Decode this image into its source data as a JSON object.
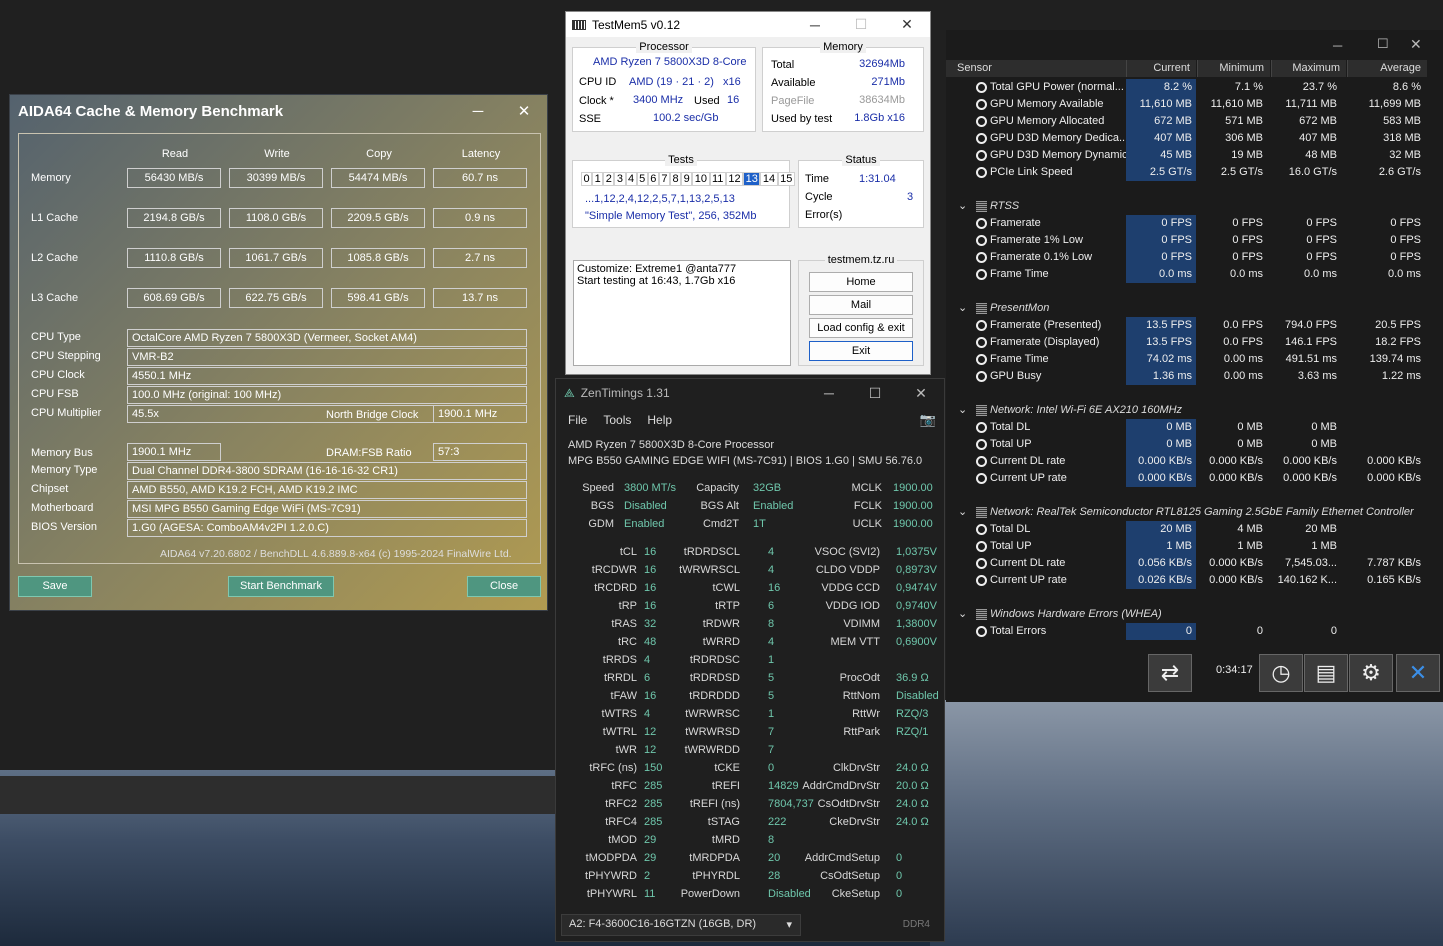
{
  "aida": {
    "title": "AIDA64 Cache & Memory Benchmark",
    "min": "─",
    "close": "✕",
    "headers": [
      "Read",
      "Write",
      "Copy",
      "Latency"
    ],
    "rows": [
      {
        "label": "Memory",
        "read": "56430 MB/s",
        "write": "30399 MB/s",
        "copy": "54474 MB/s",
        "latency": "60.7 ns"
      },
      {
        "label": "L1 Cache",
        "read": "2194.8 GB/s",
        "write": "1108.0 GB/s",
        "copy": "2209.5 GB/s",
        "latency": "0.9 ns"
      },
      {
        "label": "L2 Cache",
        "read": "1110.8 GB/s",
        "write": "1061.7 GB/s",
        "copy": "1085.8 GB/s",
        "latency": "2.7 ns"
      },
      {
        "label": "L3 Cache",
        "read": "608.69 GB/s",
        "write": "622.75 GB/s",
        "copy": "598.41 GB/s",
        "latency": "13.7 ns"
      }
    ],
    "info": [
      {
        "label": "CPU Type",
        "value": "OctalCore AMD Ryzen 7 5800X3D  (Vermeer, Socket AM4)"
      },
      {
        "label": "CPU Stepping",
        "value": "VMR-B2"
      },
      {
        "label": "CPU Clock",
        "value": "4550.1 MHz"
      },
      {
        "label": "CPU FSB",
        "value": "100.0 MHz  (original: 100 MHz)"
      },
      {
        "label": "CPU Multiplier",
        "value": "45.5x"
      }
    ],
    "nb_label": "North Bridge Clock",
    "nb_value": "1900.1 MHz",
    "bus_label": "Memory Bus",
    "bus_value": "1900.1 MHz",
    "ratio_label": "DRAM:FSB Ratio",
    "ratio_value": "57:3",
    "info2": [
      {
        "label": "Memory Type",
        "value": "Dual Channel DDR4-3800 SDRAM  (16-16-16-32 CR1)"
      },
      {
        "label": "Chipset",
        "value": "AMD B550, AMD K19.2 FCH, AMD K19.2 IMC"
      },
      {
        "label": "Motherboard",
        "value": "MSI MPG B550 Gaming Edge WiFi (MS-7C91)"
      },
      {
        "label": "BIOS Version",
        "value": "1.G0  (AGESA: ComboAM4v2PI 1.2.0.C)"
      }
    ],
    "footer": "AIDA64 v7.20.6802 / BenchDLL 4.6.889.8-x64  (c) 1995-2024 FinalWire Ltd.",
    "save": "Save",
    "start": "Start Benchmark",
    "close_btn": "Close"
  },
  "tm": {
    "title": "TestMem5 v0.12",
    "proc_title": "Processor",
    "cpu_name": "AMD Ryzen 7 5800X3D 8-Core",
    "cpuid_l": "CPU ID",
    "cpuid_v": "AMD  (19 · 21 · 2)",
    "cpuid_x": "x16",
    "clock_l": "Clock *",
    "clock_v": "3400 MHz",
    "used_l": "Used",
    "used_v": "16",
    "sse_l": "SSE",
    "sse_v": "100.2 sec/Gb",
    "mem_title": "Memory",
    "total_l": "Total",
    "total_v": "32694Mb",
    "avail_l": "Available",
    "avail_v": "271Mb",
    "pf_l": "PageFile",
    "pf_v": "38634Mb",
    "ubt_l": "Used by test",
    "ubt_v": "1.8Gb x16",
    "tests_title": "Tests",
    "tests": [
      "0",
      "1",
      "2",
      "3",
      "4",
      "5",
      "6",
      "7",
      "8",
      "9",
      "10",
      "11",
      "12",
      "13",
      "14",
      "15"
    ],
    "seq": "...1,12,2,4,12,2,5,7,1,13,2,5,13",
    "desc": "\"Simple Memory Test\", 256, 352Mb",
    "status_title": "Status",
    "time_l": "Time",
    "time_v": "1:31.04",
    "cycle_l": "Cycle",
    "cycle_v": "3",
    "err_l": "Error(s)",
    "log1": "Customize: Extreme1 @anta777",
    "log2": "Start testing at 16:43, 1.7Gb x16",
    "site": "testmem.tz.ru",
    "home": "Home",
    "mail": "Mail",
    "load": "Load config & exit",
    "exit": "Exit"
  },
  "zen": {
    "title": "ZenTimings 1.31",
    "menu": [
      "File",
      "Tools",
      "Help"
    ],
    "cpu": "AMD Ryzen 7 5800X3D 8-Core Processor",
    "board": "MPG B550 GAMING EDGE WIFI (MS-7C91) | BIOS 1.G0 | SMU 56.76.0",
    "top": [
      [
        "Speed",
        "3800 MT/s",
        "Capacity",
        "32GB",
        "MCLK",
        "1900.00"
      ],
      [
        "BGS",
        "Disabled",
        "BGS Alt",
        "Enabled",
        "FCLK",
        "1900.00"
      ],
      [
        "GDM",
        "Enabled",
        "Cmd2T",
        "1T",
        "UCLK",
        "1900.00"
      ]
    ],
    "rows": [
      [
        "tCL",
        "16",
        "tRDRDSCL",
        "4",
        "VSOC (SVI2)",
        "1,0375V"
      ],
      [
        "tRCDWR",
        "16",
        "tWRWRSCL",
        "4",
        "CLDO VDDP",
        "0,8973V"
      ],
      [
        "tRCDRD",
        "16",
        "tCWL",
        "16",
        "VDDG CCD",
        "0,9474V"
      ],
      [
        "tRP",
        "16",
        "tRTP",
        "6",
        "VDDG IOD",
        "0,9740V"
      ],
      [
        "tRAS",
        "32",
        "tRDWR",
        "8",
        "VDIMM",
        "1,3800V"
      ],
      [
        "tRC",
        "48",
        "tWRRD",
        "4",
        "MEM VTT",
        "0,6900V"
      ],
      [
        "tRRDS",
        "4",
        "tRDRDSC",
        "1",
        "",
        ""
      ],
      [
        "tRRDL",
        "6",
        "tRDRDSD",
        "5",
        "ProcOdt",
        "36.9 Ω"
      ],
      [
        "tFAW",
        "16",
        "tRDRDDD",
        "5",
        "RttNom",
        "Disabled"
      ],
      [
        "tWTRS",
        "4",
        "tWRWRSC",
        "1",
        "RttWr",
        "RZQ/3"
      ],
      [
        "tWTRL",
        "12",
        "tWRWRSD",
        "7",
        "RttPark",
        "RZQ/1"
      ],
      [
        "tWR",
        "12",
        "tWRWRDD",
        "7",
        "",
        ""
      ],
      [
        "tRFC (ns)",
        "150",
        "tCKE",
        "0",
        "ClkDrvStr",
        "24.0 Ω"
      ],
      [
        "tRFC",
        "285",
        "tREFI",
        "14829",
        "AddrCmdDrvStr",
        "20.0 Ω"
      ],
      [
        "tRFC2",
        "285",
        "tREFI (ns)",
        "7804,737",
        "CsOdtDrvStr",
        "24.0 Ω"
      ],
      [
        "tRFC4",
        "285",
        "tSTAG",
        "222",
        "CkeDrvStr",
        "24.0 Ω"
      ],
      [
        "tMOD",
        "29",
        "tMRD",
        "8",
        "",
        ""
      ],
      [
        "tMODPDA",
        "29",
        "tMRDPDA",
        "20",
        "AddrCmdSetup",
        "0"
      ],
      [
        "tPHYWRD",
        "2",
        "tPHYRDL",
        "28",
        "CsOdtSetup",
        "0"
      ],
      [
        "tPHYWRL",
        "11",
        "PowerDown",
        "Disabled",
        "CkeSetup",
        "0"
      ]
    ],
    "dimm": "A2: F4-3600C16-16GTZN (16GB, DR)",
    "ddr": "DDR4"
  },
  "hw": {
    "headers": [
      "Sensor",
      "Current",
      "Minimum",
      "Maximum",
      "Average"
    ],
    "rows": [
      {
        "t": "s",
        "n": "Total GPU Power (normal...",
        "c": "8.2 %",
        "mi": "7.1 %",
        "ma": "23.7 %",
        "a": "8.6 %"
      },
      {
        "t": "s",
        "n": "GPU Memory Available",
        "c": "11,610 MB",
        "mi": "11,610 MB",
        "ma": "11,711 MB",
        "a": "11,699 MB"
      },
      {
        "t": "s",
        "n": "GPU Memory Allocated",
        "c": "672 MB",
        "mi": "571 MB",
        "ma": "672 MB",
        "a": "583 MB"
      },
      {
        "t": "s",
        "n": "GPU D3D Memory Dedica...",
        "c": "407 MB",
        "mi": "306 MB",
        "ma": "407 MB",
        "a": "318 MB"
      },
      {
        "t": "s",
        "n": "GPU D3D Memory Dynamic",
        "c": "45 MB",
        "mi": "19 MB",
        "ma": "48 MB",
        "a": "32 MB"
      },
      {
        "t": "s",
        "n": "PCIe Link Speed",
        "c": "2.5 GT/s",
        "mi": "2.5 GT/s",
        "ma": "16.0 GT/s",
        "a": "2.6 GT/s"
      },
      {
        "t": "b"
      },
      {
        "t": "g",
        "n": "RTSS"
      },
      {
        "t": "s",
        "n": "Framerate",
        "c": "0 FPS",
        "mi": "0 FPS",
        "ma": "0 FPS",
        "a": "0 FPS"
      },
      {
        "t": "s",
        "n": "Framerate 1% Low",
        "c": "0 FPS",
        "mi": "0 FPS",
        "ma": "0 FPS",
        "a": "0 FPS"
      },
      {
        "t": "s",
        "n": "Framerate 0.1% Low",
        "c": "0 FPS",
        "mi": "0 FPS",
        "ma": "0 FPS",
        "a": "0 FPS"
      },
      {
        "t": "s",
        "n": "Frame Time",
        "c": "0.0 ms",
        "mi": "0.0 ms",
        "ma": "0.0 ms",
        "a": "0.0 ms"
      },
      {
        "t": "b"
      },
      {
        "t": "g",
        "n": "PresentMon"
      },
      {
        "t": "s",
        "n": "Framerate (Presented)",
        "c": "13.5 FPS",
        "mi": "0.0 FPS",
        "ma": "794.0 FPS",
        "a": "20.5 FPS",
        "hl": true
      },
      {
        "t": "s",
        "n": "Framerate (Displayed)",
        "c": "13.5 FPS",
        "mi": "0.0 FPS",
        "ma": "146.1 FPS",
        "a": "18.2 FPS",
        "hl": true
      },
      {
        "t": "s",
        "n": "Frame Time",
        "c": "74.02 ms",
        "mi": "0.00 ms",
        "ma": "491.51 ms",
        "a": "139.74 ms",
        "hl": true
      },
      {
        "t": "s",
        "n": "GPU Busy",
        "c": "1.36 ms",
        "mi": "0.00 ms",
        "ma": "3.63 ms",
        "a": "1.22 ms",
        "hl": true
      },
      {
        "t": "b"
      },
      {
        "t": "g",
        "n": "Network: Intel Wi-Fi 6E AX210 160MHz"
      },
      {
        "t": "s",
        "n": "Total DL",
        "c": "0 MB",
        "mi": "0 MB",
        "ma": "0 MB",
        "a": ""
      },
      {
        "t": "s",
        "n": "Total UP",
        "c": "0 MB",
        "mi": "0 MB",
        "ma": "0 MB",
        "a": ""
      },
      {
        "t": "s",
        "n": "Current DL rate",
        "c": "0.000 KB/s",
        "mi": "0.000 KB/s",
        "ma": "0.000 KB/s",
        "a": "0.000 KB/s"
      },
      {
        "t": "s",
        "n": "Current UP rate",
        "c": "0.000 KB/s",
        "mi": "0.000 KB/s",
        "ma": "0.000 KB/s",
        "a": "0.000 KB/s"
      },
      {
        "t": "b"
      },
      {
        "t": "g",
        "n": "Network: RealTek Semiconductor RTL8125 Gaming 2.5GbE Family Ethernet Controller"
      },
      {
        "t": "s",
        "n": "Total DL",
        "c": "20 MB",
        "mi": "4 MB",
        "ma": "20 MB",
        "a": ""
      },
      {
        "t": "s",
        "n": "Total UP",
        "c": "1 MB",
        "mi": "1 MB",
        "ma": "1 MB",
        "a": ""
      },
      {
        "t": "s",
        "n": "Current DL rate",
        "c": "0.056 KB/s",
        "mi": "0.000 KB/s",
        "ma": "7,545.03...",
        "a": "7.787 KB/s"
      },
      {
        "t": "s",
        "n": "Current UP rate",
        "c": "0.026 KB/s",
        "mi": "0.000 KB/s",
        "ma": "140.162 K...",
        "a": "0.165 KB/s"
      },
      {
        "t": "b"
      },
      {
        "t": "g",
        "n": "Windows Hardware Errors (WHEA)"
      },
      {
        "t": "s",
        "n": "Total Errors",
        "c": "0",
        "mi": "0",
        "ma": "0",
        "a": ""
      }
    ],
    "clock": "0:34:17"
  }
}
